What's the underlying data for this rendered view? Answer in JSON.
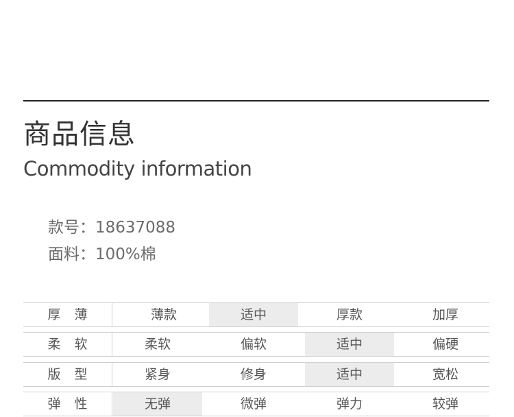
{
  "heading": {
    "title_cn": "商品信息",
    "title_en": "Commodity information"
  },
  "info": {
    "style_no": "款号：18637088",
    "fabric": "面料：100%棉"
  },
  "specs": [
    {
      "label": "厚薄",
      "options": [
        "薄款",
        "适中",
        "厚款",
        "加厚"
      ],
      "selected": "适中"
    },
    {
      "label": "柔软",
      "options": [
        "柔软",
        "偏软",
        "适中",
        "偏硬"
      ],
      "selected": "适中"
    },
    {
      "label": "版型",
      "options": [
        "紧身",
        "修身",
        "适中",
        "宽松"
      ],
      "selected": "适中"
    },
    {
      "label": "弹性",
      "options": [
        "无弹",
        "微弹",
        "弹力",
        "较弹"
      ],
      "selected": "无弹"
    }
  ]
}
